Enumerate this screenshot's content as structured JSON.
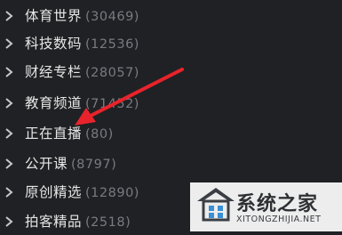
{
  "categories": [
    {
      "label": "体育世界",
      "count": "(30469)"
    },
    {
      "label": "科技数码",
      "count": "(12536)"
    },
    {
      "label": "财经专栏",
      "count": "(28057)"
    },
    {
      "label": "教育频道",
      "count": "(71452)"
    },
    {
      "label": "正在直播",
      "count": "(80)"
    },
    {
      "label": "公开课",
      "count": "(8797)"
    },
    {
      "label": "原创精选",
      "count": "(12890)"
    },
    {
      "label": "拍客精品",
      "count": "(2518)"
    }
  ],
  "watermark": {
    "title": "系统之家",
    "url": "XITONGZHIJIA.NET"
  },
  "colors": {
    "background": "#202124",
    "label": "#e6e6e6",
    "count": "#777b80",
    "arrow": "#e8232b"
  }
}
